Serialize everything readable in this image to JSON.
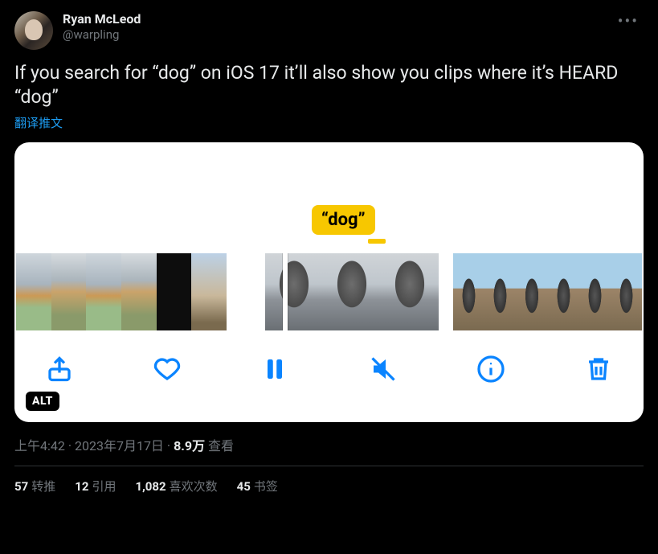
{
  "author": {
    "display_name": "Ryan McLeod",
    "handle": "@warpling"
  },
  "body": "If you search for “dog” on iOS 17 it’ll also show you clips where it’s HEARD “dog”",
  "translate_label": "翻译推文",
  "media": {
    "caption_tag": "“dog”",
    "alt_badge": "ALT"
  },
  "meta": {
    "time": "上午4:42",
    "dot1": " · ",
    "date": "2023年7月17日",
    "dot2": " · ",
    "views_n": "8.9万",
    "views_label": " 查看"
  },
  "stats": {
    "retweets_n": "57",
    "retweets_label": "转推",
    "quotes_n": "12",
    "quotes_label": "引用",
    "likes_n": "1,082",
    "likes_label": "喜欢次数",
    "bookmarks_n": "45",
    "bookmarks_label": "书签"
  }
}
